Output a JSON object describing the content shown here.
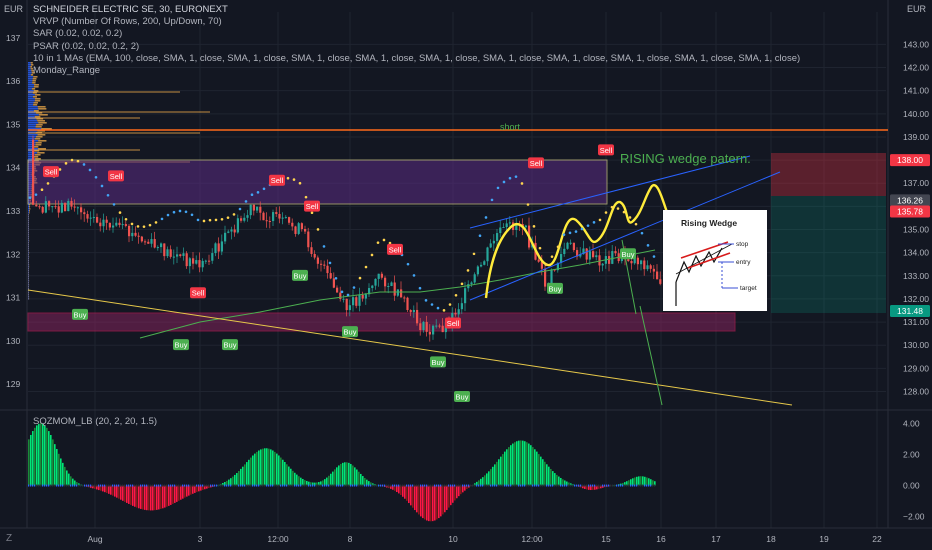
{
  "header": {
    "title": "SCHNEIDER ELECTRIC SE, 30, EURONEXT",
    "indicators": [
      "VRVP (Number Of Rows, 200, Up/Down, 70)",
      "SAR (0.02, 0.02, 0.2)",
      "PSAR (0.02, 0.02, 0.2, 2)",
      "10 in 1 MAs (EMA, 100, close, SMA, 1, close, SMA, 1, close, SMA, 1, close, SMA, 1, close, SMA, 1, close, SMA, 1, close, SMA, 1, close, SMA, 1, close, SMA, 1, close, SMA, 1, close)",
      "Monday_Range"
    ],
    "currency_left": "EUR",
    "currency_right": "EUR"
  },
  "lower_pane": {
    "label": "SQZMOM_LB (20, 2, 20, 1.5)"
  },
  "footer": {
    "gear_glyph": "Z"
  },
  "chart_data": {
    "type": "candlestick",
    "left_axis": {
      "ticks": [
        137,
        136,
        135,
        134,
        133,
        132,
        131,
        130,
        129
      ],
      "ylim": [
        128.4,
        137.6
      ]
    },
    "right_axis": {
      "ticks": [
        "143.00",
        "142.00",
        "141.00",
        "140.00",
        "139.00",
        "138.00",
        "137.00",
        "136.00",
        "135.00",
        "134.00",
        "133.00",
        "132.00",
        "131.00",
        "130.00",
        "129.00",
        "128.00"
      ],
      "ylim": [
        127.2,
        144.4
      ]
    },
    "x_axis": {
      "ticks": [
        "Aug",
        "3",
        "12:00",
        "8",
        "10",
        "12:00",
        "15",
        "16",
        "17",
        "18",
        "19",
        "22"
      ]
    },
    "price_badges": [
      {
        "label": "138.00",
        "color": "#f23645"
      },
      {
        "label": "136.26",
        "color": "#434651"
      },
      {
        "label": "135.78",
        "color": "#f23645"
      },
      {
        "label": "131.48",
        "color": "#089981"
      }
    ],
    "levels": [
      {
        "name": "short",
        "value": 139.3,
        "color": "#ff6a1a"
      }
    ],
    "annotations": {
      "wedge_title": "RISING wedge patern.",
      "short_label": "short",
      "inset_title": "Rising Wedge",
      "inset_stop": "stop",
      "inset_entry": "entry",
      "inset_target": "target"
    },
    "signals": [
      {
        "type": "Sell",
        "x": "Jul 31",
        "price": 133.9
      },
      {
        "type": "Sell",
        "x": "Aug 1",
        "price": 133.8
      },
      {
        "type": "Buy",
        "x": "Jul 31",
        "price": 130.6
      },
      {
        "type": "Sell",
        "x": "Aug 2",
        "price": 131.1
      },
      {
        "type": "Buy",
        "x": "Aug 2",
        "price": 129.9
      },
      {
        "type": "Buy",
        "x": "Aug 3",
        "price": 129.9
      },
      {
        "type": "Sell",
        "x": "Aug 4",
        "price": 133.7
      },
      {
        "type": "Sell",
        "x": "Aug 5",
        "price": 133.1
      },
      {
        "type": "Buy",
        "x": "Aug 5",
        "price": 131.5
      },
      {
        "type": "Buy",
        "x": "Aug 8",
        "price": 130.2
      },
      {
        "type": "Sell",
        "x": "Aug 9",
        "price": 132.1
      },
      {
        "type": "Buy",
        "x": "Aug 9",
        "price": 129.5
      },
      {
        "type": "Sell",
        "x": "Aug 10",
        "price": 130.4
      },
      {
        "type": "Buy",
        "x": "Aug 10",
        "price": 128.7
      },
      {
        "type": "Sell",
        "x": "Aug 12",
        "price": 134.1
      },
      {
        "type": "Buy",
        "x": "Aug 12",
        "price": 131.2
      },
      {
        "type": "Sell",
        "x": "Aug 15",
        "price": 134.4
      },
      {
        "type": "Buy",
        "x": "Aug 15",
        "price": 132.0
      }
    ],
    "momentum_axis": {
      "ticks": [
        "4.00",
        "2.00",
        "0.00",
        "−2.00"
      ],
      "ylim": [
        -2.6,
        4.6
      ]
    }
  }
}
